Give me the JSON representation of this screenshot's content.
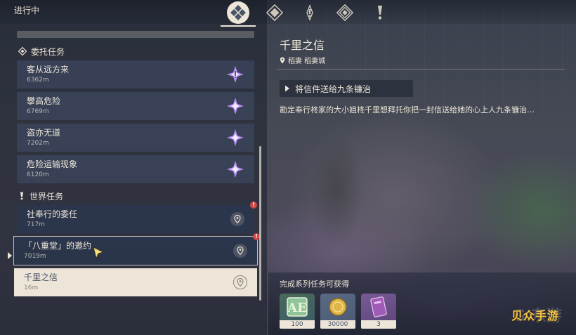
{
  "header": {
    "title": "进行中",
    "tabs": [
      {
        "name": "all",
        "icon": "quest-all-icon",
        "active": true
      },
      {
        "name": "commission",
        "icon": "commission-diamond-icon",
        "active": false
      },
      {
        "name": "world",
        "icon": "world-quest-icon",
        "active": false
      },
      {
        "name": "archon",
        "icon": "archon-quest-icon",
        "active": false
      },
      {
        "name": "event",
        "icon": "exclamation-icon",
        "active": false
      }
    ]
  },
  "sections": {
    "commission": {
      "label": "委托任务",
      "items": [
        {
          "name": "客从远方来",
          "distance": "6362m"
        },
        {
          "name": "攀高危险",
          "distance": "6769m"
        },
        {
          "name": "盗亦无道",
          "distance": "7202m"
        },
        {
          "name": "危险运输现象",
          "distance": "6120m"
        }
      ]
    },
    "world": {
      "label": "世界任务",
      "items": [
        {
          "name": "社奉行的委任",
          "distance": "717m",
          "alert": "!"
        },
        {
          "name": "「八重堂」的邀约",
          "distance": "7019m",
          "alert": "!"
        },
        {
          "name": "千里之信",
          "distance": "16m"
        }
      ]
    }
  },
  "detail": {
    "title": "千里之信",
    "location": "稻妻 稻妻城",
    "step": "将信件送给九条镰治",
    "description": "勘定奉行柊家的大小姐柊千里想拜托你把一封信送给她的心上人九条镰治…",
    "reward_title": "完成系列任务可获得",
    "rewards": [
      {
        "icon": "adventure-exp-icon",
        "qty": "100"
      },
      {
        "icon": "mora-coin-icon",
        "qty": "30000"
      },
      {
        "icon": "heros-wit-book-icon",
        "qty": "3"
      }
    ]
  },
  "watermark": {
    "text": "贝众手游",
    "ghost": "G 东游"
  },
  "colors": {
    "text": "#ece5d8",
    "card": "#3a445c",
    "selected": "#ece5d8",
    "commission_star": "#b48cf0",
    "alert": "#d14646"
  }
}
